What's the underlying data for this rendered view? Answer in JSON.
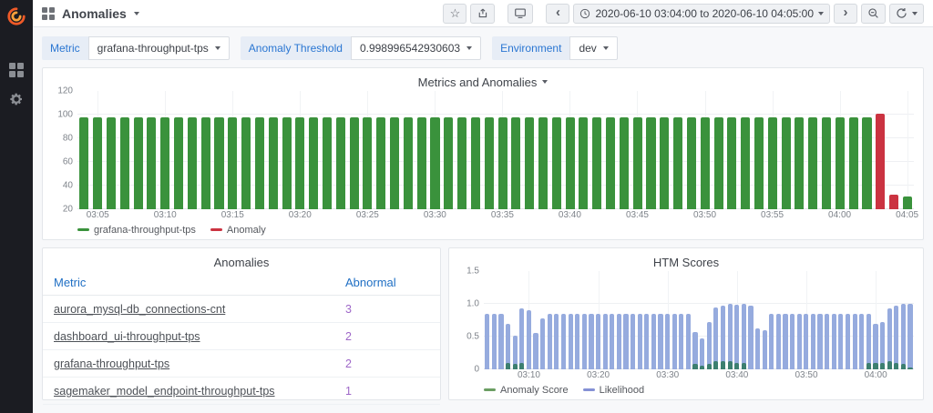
{
  "header": {
    "title": "Anomalies",
    "time_range": "2020-06-10 03:04:00 to 2020-06-10 04:05:00"
  },
  "filters": {
    "metric": {
      "label": "Metric",
      "value": "grafana-throughput-tps"
    },
    "threshold": {
      "label": "Anomaly Threshold",
      "value": "0.998996542930603"
    },
    "environment": {
      "label": "Environment",
      "value": "dev"
    }
  },
  "panels": {
    "anomalies": {
      "title": "Anomalies",
      "columns": [
        "Metric",
        "Abnormal"
      ],
      "rows": [
        {
          "metric": "aurora_mysql-db_connections-cnt",
          "abnormal": "3"
        },
        {
          "metric": "dashboard_ui-throughput-tps",
          "abnormal": "2"
        },
        {
          "metric": "grafana-throughput-tps",
          "abnormal": "2"
        },
        {
          "metric": "sagemaker_model_endpoint-throughput-tps",
          "abnormal": "1"
        }
      ]
    }
  },
  "colors": {
    "metric_green": "#3a923c",
    "anomaly_red": "#cb3341",
    "likelihood_blue": "#96abde",
    "anomaly_score_green": "#3c7f70",
    "legend_anomaly_score": "#6b9e63",
    "legend_likelihood": "#8591d5",
    "link_blue": "#1f6fc4",
    "abnormal_purple": "#9e67c8",
    "brand_orange": "#f05a28"
  },
  "chart_data": [
    {
      "type": "bar",
      "title": "Metrics and Anomalies",
      "ylim": [
        20,
        120
      ],
      "yticks": [
        20,
        40,
        60,
        80,
        100,
        120
      ],
      "ytick_labels": [
        "20",
        "40",
        "60",
        "80",
        "100",
        "120"
      ],
      "xtick_every_min": 5,
      "legend": [
        "grafana-throughput-tps",
        "Anomaly"
      ],
      "x": [
        "03:04",
        "03:05",
        "03:06",
        "03:07",
        "03:08",
        "03:09",
        "03:10",
        "03:11",
        "03:12",
        "03:13",
        "03:14",
        "03:15",
        "03:16",
        "03:17",
        "03:18",
        "03:19",
        "03:20",
        "03:21",
        "03:22",
        "03:23",
        "03:24",
        "03:25",
        "03:26",
        "03:27",
        "03:28",
        "03:29",
        "03:30",
        "03:31",
        "03:32",
        "03:33",
        "03:34",
        "03:35",
        "03:36",
        "03:37",
        "03:38",
        "03:39",
        "03:40",
        "03:41",
        "03:42",
        "03:43",
        "03:44",
        "03:45",
        "03:46",
        "03:47",
        "03:48",
        "03:49",
        "03:50",
        "03:51",
        "03:52",
        "03:53",
        "03:54",
        "03:55",
        "03:56",
        "03:57",
        "03:58",
        "03:59",
        "04:00",
        "04:01",
        "04:02",
        "04:03",
        "04:04",
        "04:05"
      ],
      "values": [
        98,
        98,
        98,
        98,
        98,
        98,
        98,
        98,
        98,
        98,
        98,
        98,
        98,
        98,
        98,
        98,
        98,
        98,
        98,
        98,
        98,
        98,
        98,
        98,
        98,
        98,
        98,
        98,
        98,
        98,
        98,
        98,
        98,
        98,
        98,
        98,
        98,
        98,
        98,
        98,
        98,
        98,
        98,
        98,
        98,
        98,
        98,
        98,
        98,
        98,
        98,
        98,
        98,
        98,
        98,
        98,
        98,
        98,
        98,
        101,
        32,
        31
      ],
      "anomaly_indices": [
        59,
        60
      ]
    },
    {
      "type": "bar",
      "title": "HTM Scores",
      "ylim": [
        0,
        1.5
      ],
      "yticks": [
        0,
        0.5,
        1.0,
        1.5
      ],
      "ytick_labels": [
        "0",
        "0.5",
        "1.0",
        "1.5"
      ],
      "xtick_every_min": 10,
      "x": [
        "03:04",
        "03:05",
        "03:06",
        "03:07",
        "03:08",
        "03:09",
        "03:10",
        "03:11",
        "03:12",
        "03:13",
        "03:14",
        "03:15",
        "03:16",
        "03:17",
        "03:18",
        "03:19",
        "03:20",
        "03:21",
        "03:22",
        "03:23",
        "03:24",
        "03:25",
        "03:26",
        "03:27",
        "03:28",
        "03:29",
        "03:30",
        "03:31",
        "03:32",
        "03:33",
        "03:34",
        "03:35",
        "03:36",
        "03:37",
        "03:38",
        "03:39",
        "03:40",
        "03:41",
        "03:42",
        "03:43",
        "03:44",
        "03:45",
        "03:46",
        "03:47",
        "03:48",
        "03:49",
        "03:50",
        "03:51",
        "03:52",
        "03:53",
        "03:54",
        "03:55",
        "03:56",
        "03:57",
        "03:58",
        "03:59",
        "04:00",
        "04:01",
        "04:02",
        "04:03",
        "04:04",
        "04:05"
      ],
      "series": [
        {
          "name": "Anomaly Score",
          "values": [
            0,
            0,
            0,
            0.1,
            0.08,
            0.1,
            0,
            0,
            0,
            0,
            0,
            0,
            0,
            0,
            0,
            0,
            0,
            0,
            0,
            0,
            0,
            0,
            0,
            0,
            0,
            0,
            0,
            0,
            0,
            0,
            0.08,
            0.06,
            0.08,
            0.12,
            0.12,
            0.12,
            0.1,
            0.1,
            0,
            0,
            0,
            0,
            0,
            0,
            0,
            0,
            0,
            0,
            0,
            0,
            0,
            0,
            0,
            0,
            0,
            0.1,
            0.1,
            0.1,
            0.12,
            0.1,
            0.08,
            0.03
          ]
        },
        {
          "name": "Likelihood",
          "values": [
            0.85,
            0.85,
            0.85,
            0.7,
            0.52,
            0.93,
            0.9,
            0.55,
            0.78,
            0.85,
            0.85,
            0.85,
            0.85,
            0.85,
            0.85,
            0.85,
            0.85,
            0.85,
            0.85,
            0.85,
            0.85,
            0.85,
            0.85,
            0.85,
            0.85,
            0.85,
            0.85,
            0.85,
            0.85,
            0.85,
            0.57,
            0.47,
            0.72,
            0.95,
            0.97,
            1.0,
            0.98,
            1.0,
            0.97,
            0.62,
            0.6,
            0.85,
            0.85,
            0.85,
            0.85,
            0.85,
            0.85,
            0.85,
            0.85,
            0.85,
            0.85,
            0.85,
            0.85,
            0.85,
            0.85,
            0.85,
            0.7,
            0.72,
            0.93,
            0.97,
            1.0,
            1.0
          ]
        }
      ]
    }
  ]
}
